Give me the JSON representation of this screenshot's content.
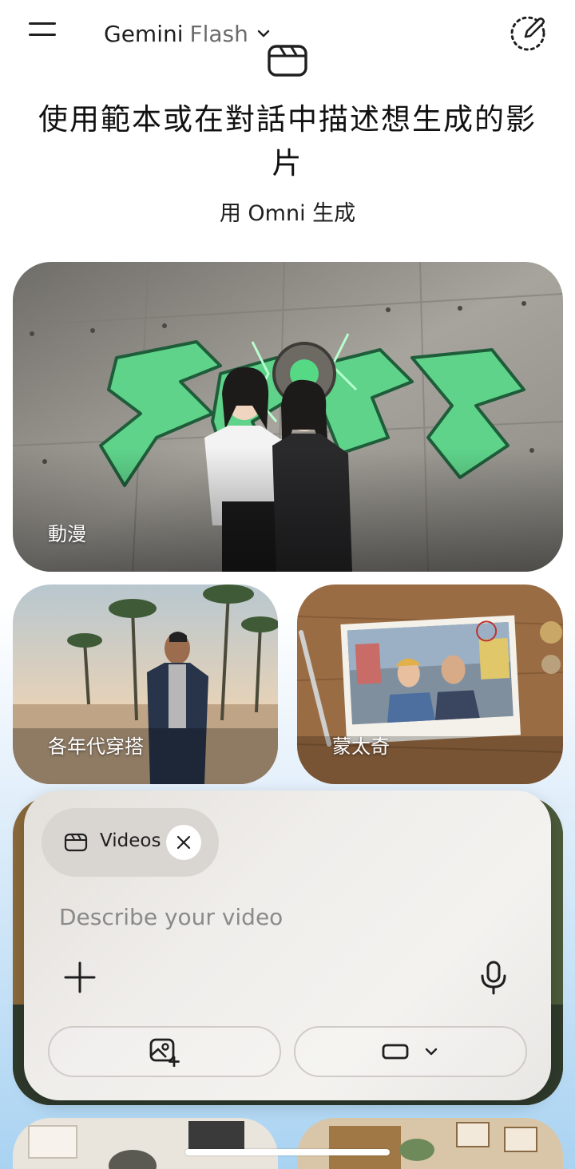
{
  "header": {
    "model_name": "Gemini",
    "model_variant": "Flash",
    "icons": [
      "menu-icon",
      "chevron-down-icon",
      "new-chat-icon",
      "video-icon"
    ]
  },
  "intro": {
    "title": "使用範本或在對話中描述想生成的影片",
    "subtitle": "用 Omni 生成"
  },
  "templates": [
    {
      "label": "動漫"
    },
    {
      "label": "各年代穿搭"
    },
    {
      "label": "蒙太奇"
    }
  ],
  "composer": {
    "chip_label": "Videos",
    "placeholder": "Describe your video",
    "icons": [
      "plus-icon",
      "mic-icon",
      "add-photo-icon",
      "aspect-ratio-icon",
      "close-icon"
    ]
  },
  "colors": {
    "background_top": "#ffffff",
    "background_bottom": "#a9d3f2",
    "graffiti_green": "#5fd38a",
    "composer_bg": "#f0eeeb"
  }
}
